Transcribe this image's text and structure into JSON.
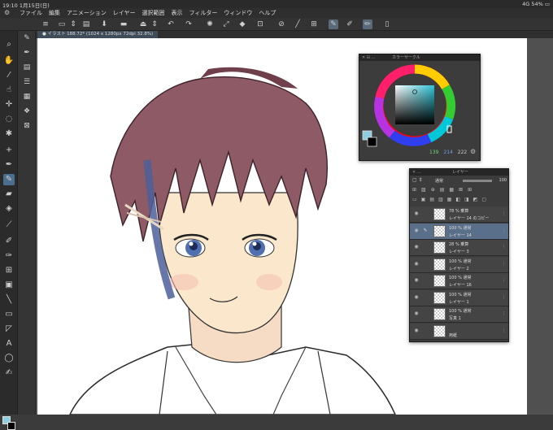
{
  "status": {
    "time": "19:10",
    "date": "1月15日(日)",
    "network": "4G",
    "battery": "54%"
  },
  "menu": [
    "ファイル",
    "編集",
    "アニメーション",
    "レイヤー",
    "選択範囲",
    "表示",
    "フィルター",
    "ウィンドウ",
    "ヘルプ"
  ],
  "tab": {
    "label": "● イラスト 188.72* (1024 x 1280px 72dpi 32.8%)"
  },
  "color_panel": {
    "title": "カラーサークル",
    "values": {
      "h": "139",
      "s": "214",
      "v": "222"
    },
    "main_color": "#8ecde0",
    "sub_color": "#000000"
  },
  "layer_panel": {
    "title": "レイヤー",
    "blend_mode": "通常",
    "opacity_value": "100",
    "layers": [
      {
        "blend": "78 % 乗算",
        "name": "レイヤー 14 のコピー",
        "selected": false,
        "pen": false
      },
      {
        "blend": "100 % 通常",
        "name": "レイヤー 14",
        "selected": true,
        "pen": true
      },
      {
        "blend": "28 % 乗算",
        "name": "レイヤー 3",
        "selected": false,
        "pen": false
      },
      {
        "blend": "100 % 通常",
        "name": "レイヤー 2",
        "selected": false,
        "pen": false
      },
      {
        "blend": "100 % 通常",
        "name": "レイヤー 16",
        "selected": false,
        "pen": false
      },
      {
        "blend": "100 % 通常",
        "name": "レイヤー 1",
        "selected": false,
        "pen": false
      },
      {
        "blend": "100 % 通常",
        "name": "写真 1",
        "selected": false,
        "pen": false
      },
      {
        "blend": "",
        "name": "用紙",
        "selected": false,
        "pen": false
      }
    ]
  },
  "colors": {
    "accent": "#4d6f8f",
    "selected_layer": "#5a6f89"
  }
}
